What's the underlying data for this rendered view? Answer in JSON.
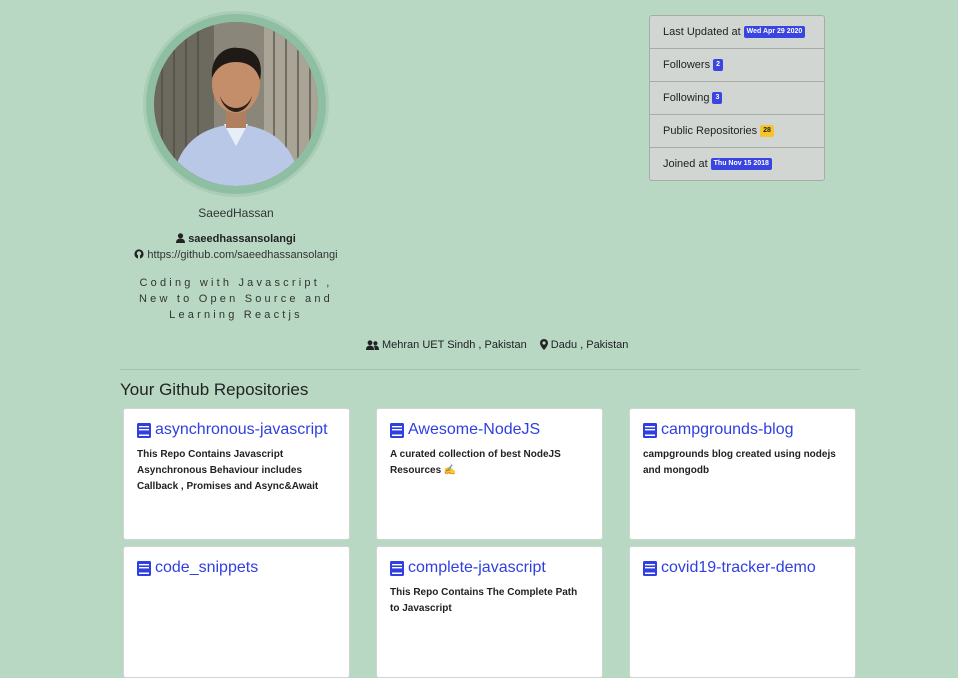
{
  "profile": {
    "name": "SaeedHassan",
    "login": "saeedhassansolangi",
    "url": "https://github.com/saeedhassansolangi",
    "bio": "Coding with Javascript , New to Open Source and Learning Reactjs",
    "company": "Mehran UET Sindh , Pakistan",
    "location": "Dadu , Pakistan"
  },
  "stats": [
    {
      "label": "Last Updated at",
      "badge": "Wed Apr 29 2020",
      "badge_color": "#3a44e0"
    },
    {
      "label": "Followers",
      "badge": "2",
      "badge_color": "#3a44e0"
    },
    {
      "label": "Following",
      "badge": "3",
      "badge_color": "#3a44e0"
    },
    {
      "label": "Public Repositories",
      "badge": "28",
      "badge_color": "#f6c52c"
    },
    {
      "label": "Joined at",
      "badge": "Thu Nov 15 2018",
      "badge_color": "#3a44e0"
    }
  ],
  "repos_title": "Your Github Repositories",
  "repos": [
    {
      "name": "asynchronous-javascript",
      "description": "This Repo Contains Javascript Asynchronous Behaviour includes Callback , Promises and Async&Await"
    },
    {
      "name": "Awesome-NodeJS",
      "description": "A curated collection of best NodeJS Resources ✍️"
    },
    {
      "name": "campgrounds-blog",
      "description": "campgrounds blog created using nodejs and mongodb"
    },
    {
      "name": "code_snippets",
      "description": ""
    },
    {
      "name": "complete-javascript",
      "description": "This Repo Contains The Complete Path to Javascript"
    },
    {
      "name": "covid19-tracker-demo",
      "description": ""
    }
  ],
  "icons": {
    "user": "user-icon",
    "github": "github-icon",
    "users": "users-icon",
    "location": "map-marker-icon",
    "repo": "book-icon"
  },
  "colors": {
    "background": "#b8d8c4",
    "link": "#2f3fe0",
    "badge_blue": "#3a44e0",
    "badge_yellow": "#f6c52c"
  }
}
